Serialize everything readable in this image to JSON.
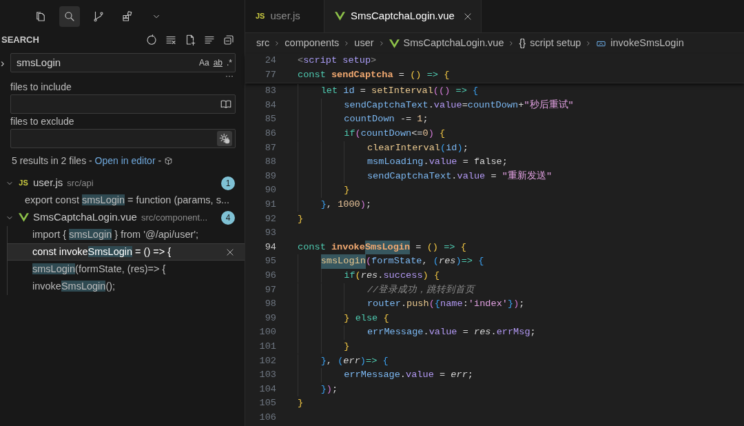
{
  "activity_bar": {
    "items": [
      {
        "kind": "files",
        "selected": false
      },
      {
        "kind": "search",
        "selected": true
      },
      {
        "kind": "source-control",
        "selected": false
      },
      {
        "kind": "extensions",
        "selected": false
      },
      {
        "kind": "more",
        "selected": false
      }
    ]
  },
  "search": {
    "title": "SEARCH",
    "actions": [
      {
        "kind": "refresh"
      },
      {
        "kind": "clear"
      },
      {
        "kind": "new-file"
      },
      {
        "kind": "list"
      },
      {
        "kind": "collapse"
      }
    ],
    "replace_toggle": "›",
    "query": "smsLogin",
    "toggles": [
      {
        "label": "Aa",
        "kind": "case"
      },
      {
        "label": "ab",
        "kind": "word"
      },
      {
        "label": ".*",
        "kind": "regex"
      }
    ],
    "details": "···",
    "include": {
      "label": "files to include",
      "kind": "book"
    },
    "exclude": {
      "label": "files to exclude",
      "kind": "gear"
    },
    "message": "5 results in 2 files - ",
    "link": "Open in editor",
    "message_tail": " - ",
    "files": [
      {
        "kind": "js",
        "icon_text": "JS",
        "name": "user.js",
        "path": "src/api",
        "count": "1",
        "expanded": true,
        "matches": [
          {
            "before": "export const ",
            "match": "smsLogin",
            "after": " = function (params, s...",
            "selected": false
          }
        ]
      },
      {
        "kind": "vue",
        "name": "SmsCaptchaLogin.vue",
        "path": "src/component...",
        "count": "4",
        "expanded": true,
        "matches": [
          {
            "before": "import { ",
            "match": "smsLogin",
            "after": " } from '@/api/user';",
            "selected": false
          },
          {
            "before": "const invoke",
            "match": "SmsLogin",
            "after": " = () => {",
            "selected": true
          },
          {
            "match": "smsLogin",
            "after": "(formState, (res)=> {",
            "selected": false
          },
          {
            "before": "invoke",
            "match": "SmsLogin",
            "after": "();",
            "selected": false
          }
        ]
      }
    ]
  },
  "editor": {
    "tabs": [
      {
        "kind": "js",
        "icon_text": "JS",
        "label": "user.js",
        "selected": false
      },
      {
        "kind": "vue",
        "label": "SmsCaptchaLogin.vue",
        "selected": true
      }
    ],
    "breadcrumb": [
      {
        "kind": "folder",
        "label": "src"
      },
      {
        "kind": "folder",
        "label": "components"
      },
      {
        "kind": "folder",
        "label": "user"
      },
      {
        "kind": "vue",
        "label": "SmsCaptchaLogin.vue"
      },
      {
        "kind": "braces",
        "icon_text": "{}",
        "label": "script setup"
      },
      {
        "kind": "variable",
        "label": "invokeSmsLogin"
      }
    ],
    "sticky_lines": [
      {
        "number": "24",
        "tokens": [
          {
            "text": "<",
            "kind": "punc"
          },
          {
            "text": "script setup",
            "kind": "tag"
          },
          {
            "text": ">",
            "kind": "punc"
          }
        ]
      },
      {
        "number": "77",
        "tokens": [
          {
            "text": "const ",
            "kind": "keyword"
          },
          {
            "text": "sendCaptcha",
            "kind": "decl"
          },
          {
            "text": " = ",
            "kind": "plain"
          },
          {
            "text": "()",
            "kind": "b1"
          },
          {
            "text": " => ",
            "kind": "keyword"
          },
          {
            "text": "{",
            "kind": "b1"
          }
        ]
      }
    ],
    "lines": [
      {
        "number": "83",
        "current": false,
        "tokens": [
          {
            "text": "    let ",
            "kind": "keyword"
          },
          {
            "text": "id",
            "kind": "var"
          },
          {
            "text": " = ",
            "kind": "plain"
          },
          {
            "text": "setInterval",
            "kind": "call"
          },
          {
            "text": "(()",
            "kind": "b2"
          },
          {
            "text": " => ",
            "kind": "keyword"
          },
          {
            "text": "{",
            "kind": "b3"
          }
        ]
      },
      {
        "number": "84",
        "current": false,
        "tokens": [
          {
            "text": "        sendCaptchaText",
            "kind": "var"
          },
          {
            "text": ".",
            "kind": "plain"
          },
          {
            "text": "value",
            "kind": "prop"
          },
          {
            "text": "=",
            "kind": "plain"
          },
          {
            "text": "countDown",
            "kind": "var"
          },
          {
            "text": "+",
            "kind": "plain"
          },
          {
            "text": "\"秒后重试\"",
            "kind": "string"
          }
        ]
      },
      {
        "number": "85",
        "current": false,
        "tokens": [
          {
            "text": "        countDown",
            "kind": "var"
          },
          {
            "text": " -= ",
            "kind": "plain"
          },
          {
            "text": "1",
            "kind": "number"
          },
          {
            "text": ";",
            "kind": "plain"
          }
        ]
      },
      {
        "number": "86",
        "current": false,
        "tokens": [
          {
            "text": "        if",
            "kind": "keyword"
          },
          {
            "text": "(",
            "kind": "b2"
          },
          {
            "text": "countDown",
            "kind": "var"
          },
          {
            "text": "<=",
            "kind": "plain"
          },
          {
            "text": "0",
            "kind": "number"
          },
          {
            "text": ")",
            "kind": "b2"
          },
          {
            "text": " {",
            "kind": "b1"
          }
        ]
      },
      {
        "number": "87",
        "current": false,
        "tokens": [
          {
            "text": "            clearInterval",
            "kind": "call"
          },
          {
            "text": "(",
            "kind": "b3"
          },
          {
            "text": "id",
            "kind": "var"
          },
          {
            "text": ")",
            "kind": "b3"
          },
          {
            "text": ";",
            "kind": "plain"
          }
        ]
      },
      {
        "number": "88",
        "current": false,
        "tokens": [
          {
            "text": "            msmLoading",
            "kind": "var"
          },
          {
            "text": ".",
            "kind": "plain"
          },
          {
            "text": "value",
            "kind": "prop"
          },
          {
            "text": " = false;",
            "kind": "plain"
          }
        ]
      },
      {
        "number": "89",
        "current": false,
        "tokens": [
          {
            "text": "            sendCaptchaText",
            "kind": "var"
          },
          {
            "text": ".",
            "kind": "plain"
          },
          {
            "text": "value",
            "kind": "prop"
          },
          {
            "text": " = ",
            "kind": "plain"
          },
          {
            "text": "\"重新发送\"",
            "kind": "string"
          }
        ]
      },
      {
        "number": "90",
        "current": false,
        "tokens": [
          {
            "text": "        }",
            "kind": "b1"
          }
        ]
      },
      {
        "number": "91",
        "current": false,
        "tokens": [
          {
            "text": "    }",
            "kind": "b3"
          },
          {
            "text": ", ",
            "kind": "plain"
          },
          {
            "text": "1000",
            "kind": "number"
          },
          {
            "text": ")",
            "kind": "b2"
          },
          {
            "text": ";",
            "kind": "plain"
          }
        ]
      },
      {
        "number": "92",
        "current": false,
        "tokens": [
          {
            "text": "}",
            "kind": "b1"
          }
        ]
      },
      {
        "number": "93",
        "current": false
      },
      {
        "number": "94",
        "current": true,
        "tokens": [
          {
            "text": "const ",
            "kind": "keyword"
          },
          {
            "text": "invoke",
            "kind": "decl"
          },
          {
            "text": "SmsLogin",
            "kind": "decl",
            "match": true
          },
          {
            "text": " = ",
            "kind": "plain"
          },
          {
            "text": "()",
            "kind": "b1"
          },
          {
            "text": " => ",
            "kind": "keyword"
          },
          {
            "text": "{",
            "kind": "b1"
          }
        ]
      },
      {
        "number": "95",
        "current": false,
        "tokens": [
          {
            "text": "    smsLogin",
            "kind": "call",
            "match": true
          },
          {
            "text": "(",
            "kind": "b2"
          },
          {
            "text": "formState",
            "kind": "var"
          },
          {
            "text": ", ",
            "kind": "plain"
          },
          {
            "text": "(",
            "kind": "b3"
          },
          {
            "text": "res",
            "kind": "param"
          },
          {
            "text": ")",
            "kind": "b3"
          },
          {
            "text": "=>",
            "kind": "keyword"
          },
          {
            "text": " {",
            "kind": "b3"
          }
        ]
      },
      {
        "number": "96",
        "current": false,
        "tokens": [
          {
            "text": "        if",
            "kind": "keyword"
          },
          {
            "text": "(",
            "kind": "b1"
          },
          {
            "text": "res",
            "kind": "param"
          },
          {
            "text": ".",
            "kind": "plain"
          },
          {
            "text": "success",
            "kind": "prop"
          },
          {
            "text": ")",
            "kind": "b1"
          },
          {
            "text": " {",
            "kind": "b1"
          }
        ]
      },
      {
        "number": "97",
        "current": false,
        "tokens": [
          {
            "text": "            //登录成功，跳转到首页",
            "kind": "comment"
          }
        ]
      },
      {
        "number": "98",
        "current": false,
        "tokens": [
          {
            "text": "            router",
            "kind": "var"
          },
          {
            "text": ".",
            "kind": "plain"
          },
          {
            "text": "push",
            "kind": "call"
          },
          {
            "text": "(",
            "kind": "b2"
          },
          {
            "text": "{",
            "kind": "b3"
          },
          {
            "text": "name",
            "kind": "prop"
          },
          {
            "text": ":",
            "kind": "plain"
          },
          {
            "text": "'index'",
            "kind": "string"
          },
          {
            "text": "}",
            "kind": "b3"
          },
          {
            "text": ")",
            "kind": "b2"
          },
          {
            "text": ";",
            "kind": "plain"
          }
        ]
      },
      {
        "number": "99",
        "current": false,
        "tokens": [
          {
            "text": "        }",
            "kind": "b1"
          },
          {
            "text": " else",
            "kind": "keyword"
          },
          {
            "text": " {",
            "kind": "b1"
          }
        ]
      },
      {
        "number": "100",
        "current": false,
        "tokens": [
          {
            "text": "            errMessage",
            "kind": "var"
          },
          {
            "text": ".",
            "kind": "plain"
          },
          {
            "text": "value",
            "kind": "prop"
          },
          {
            "text": " = ",
            "kind": "plain"
          },
          {
            "text": "res",
            "kind": "param"
          },
          {
            "text": ".",
            "kind": "plain"
          },
          {
            "text": "errMsg",
            "kind": "prop"
          },
          {
            "text": ";",
            "kind": "plain"
          }
        ]
      },
      {
        "number": "101",
        "current": false,
        "tokens": [
          {
            "text": "        }",
            "kind": "b1"
          }
        ]
      },
      {
        "number": "102",
        "current": false,
        "tokens": [
          {
            "text": "    }",
            "kind": "b3"
          },
          {
            "text": ", ",
            "kind": "plain"
          },
          {
            "text": "(",
            "kind": "b3"
          },
          {
            "text": "err",
            "kind": "param"
          },
          {
            "text": ")",
            "kind": "b3"
          },
          {
            "text": "=>",
            "kind": "keyword"
          },
          {
            "text": " {",
            "kind": "b3"
          }
        ]
      },
      {
        "number": "103",
        "current": false,
        "tokens": [
          {
            "text": "        errMessage",
            "kind": "var"
          },
          {
            "text": ".",
            "kind": "plain"
          },
          {
            "text": "value",
            "kind": "prop"
          },
          {
            "text": " = ",
            "kind": "plain"
          },
          {
            "text": "err",
            "kind": "param"
          },
          {
            "text": ";",
            "kind": "plain"
          }
        ]
      },
      {
        "number": "104",
        "current": false,
        "tokens": [
          {
            "text": "    }",
            "kind": "b3"
          },
          {
            "text": ")",
            "kind": "b2"
          },
          {
            "text": ";",
            "kind": "plain"
          }
        ]
      },
      {
        "number": "105",
        "current": false,
        "tokens": [
          {
            "text": "}",
            "kind": "b1"
          }
        ]
      },
      {
        "number": "106",
        "current": false
      }
    ]
  }
}
